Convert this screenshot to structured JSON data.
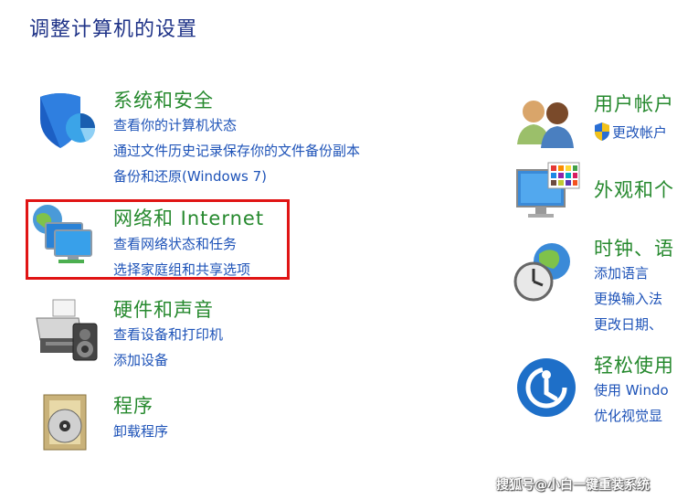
{
  "page_title": "调整计算机的设置",
  "left_categories": [
    {
      "title": "系统和安全",
      "icon": "shield-icon",
      "links": [
        "查看你的计算机状态",
        "通过文件历史记录保存你的文件备份副本",
        "备份和还原(Windows 7)"
      ]
    },
    {
      "title": "网络和 Internet",
      "icon": "network-icon",
      "links": [
        "查看网络状态和任务",
        "选择家庭组和共享选项"
      ]
    },
    {
      "title": "硬件和声音",
      "icon": "printer-speaker-icon",
      "links": [
        "查看设备和打印机",
        "添加设备"
      ]
    },
    {
      "title": "程序",
      "icon": "programs-disc-icon",
      "links": [
        "卸载程序"
      ]
    }
  ],
  "right_categories": [
    {
      "title": "用户帐户",
      "icon": "users-icon",
      "links": [
        "更改帐户"
      ]
    },
    {
      "title": "外观和个",
      "icon": "appearance-monitor-icon",
      "links": []
    },
    {
      "title": "时钟、语",
      "icon": "clock-globe-icon",
      "links": [
        "添加语言",
        "更换输入法",
        "更改日期、"
      ]
    },
    {
      "title": "轻松使用",
      "icon": "ease-of-access-icon",
      "links": [
        "使用 Windo",
        "优化视觉显"
      ]
    }
  ],
  "watermark": "搜狐号@小白一键重装系统",
  "colors": {
    "title": "#1e3287",
    "category_title": "#26892e",
    "link": "#1e53b8",
    "highlight": "#e01414"
  }
}
